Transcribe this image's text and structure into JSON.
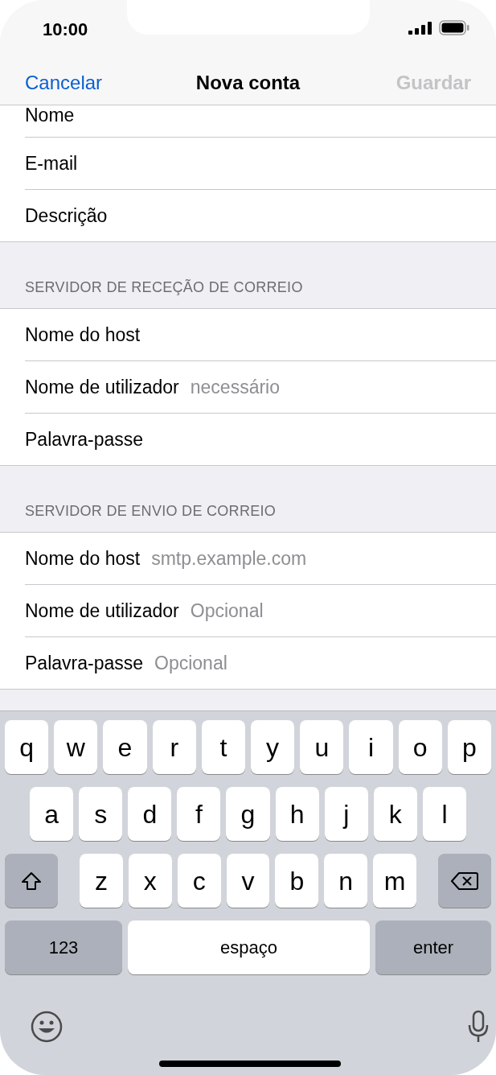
{
  "status_bar": {
    "time": "10:00"
  },
  "nav_bar": {
    "cancel": "Cancelar",
    "title": "Nova conta",
    "save": {
      "label": "Guardar",
      "disabled": true
    }
  },
  "sections": [
    {
      "rows": [
        {
          "label": "Nome",
          "clipped": true
        },
        {
          "label": "E-mail"
        },
        {
          "label": "Descrição"
        }
      ]
    },
    {
      "header": "SERVIDOR DE RECEÇÃO DE CORREIO",
      "rows": [
        {
          "label": "Nome do host"
        },
        {
          "label": "Nome de utilizador",
          "placeholder": "necessário"
        },
        {
          "label": "Palavra-passe"
        }
      ]
    },
    {
      "header": "SERVIDOR DE ENVIO DE CORREIO",
      "rows": [
        {
          "label": "Nome do host",
          "placeholder": "smtp.example.com"
        },
        {
          "label": "Nome de utilizador",
          "placeholder": "Opcional"
        },
        {
          "label": "Palavra-passe",
          "placeholder": "Opcional"
        }
      ]
    }
  ],
  "keyboard": {
    "rows": [
      {
        "keys": [
          {
            "kind": "letter",
            "label": "q"
          },
          {
            "kind": "letter",
            "label": "w"
          },
          {
            "kind": "letter",
            "label": "e"
          },
          {
            "kind": "letter",
            "label": "r"
          },
          {
            "kind": "letter",
            "label": "t"
          },
          {
            "kind": "letter",
            "label": "y"
          },
          {
            "kind": "letter",
            "label": "u"
          },
          {
            "kind": "letter",
            "label": "i"
          },
          {
            "kind": "letter",
            "label": "o"
          },
          {
            "kind": "letter",
            "label": "p"
          }
        ]
      },
      {
        "keys": [
          {
            "kind": "letter",
            "label": "a"
          },
          {
            "kind": "letter",
            "label": "s"
          },
          {
            "kind": "letter",
            "label": "d"
          },
          {
            "kind": "letter",
            "label": "f"
          },
          {
            "kind": "letter",
            "label": "g"
          },
          {
            "kind": "letter",
            "label": "h"
          },
          {
            "kind": "letter",
            "label": "j"
          },
          {
            "kind": "letter",
            "label": "k"
          },
          {
            "kind": "letter",
            "label": "l"
          }
        ]
      },
      {
        "keys": [
          {
            "kind": "shift"
          },
          {
            "kind": "letter",
            "label": "z"
          },
          {
            "kind": "letter",
            "label": "x"
          },
          {
            "kind": "letter",
            "label": "c"
          },
          {
            "kind": "letter",
            "label": "v"
          },
          {
            "kind": "letter",
            "label": "b"
          },
          {
            "kind": "letter",
            "label": "n"
          },
          {
            "kind": "letter",
            "label": "m"
          },
          {
            "kind": "backspace"
          }
        ]
      },
      {
        "keys": [
          {
            "kind": "mode",
            "label": "123"
          },
          {
            "kind": "space",
            "label": "espaço"
          },
          {
            "kind": "return",
            "label": "enter"
          }
        ]
      }
    ]
  }
}
